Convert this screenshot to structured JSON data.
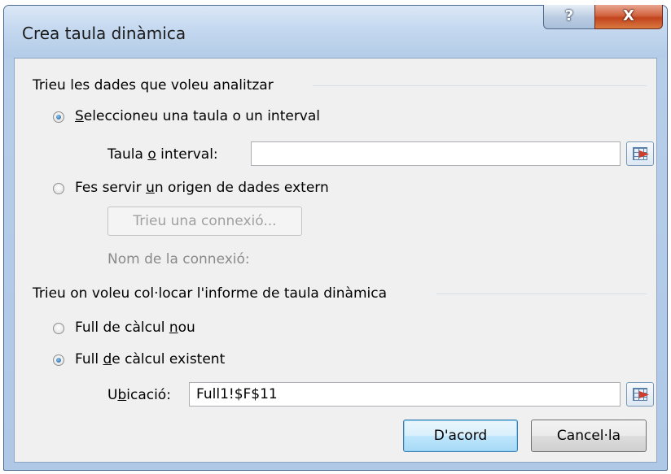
{
  "window": {
    "title": "Crea taula dinàmica",
    "help_label": "?",
    "close_label": "X"
  },
  "section_source": {
    "heading": "Trieu les dades que voleu analitzar",
    "option_table": {
      "label_pre": "",
      "label_u": "S",
      "label_post": "eleccioneu una taula o un interval",
      "checked": true
    },
    "range_field": {
      "label_pre": "Taula ",
      "label_u": "o",
      "label_post": " interval:",
      "value": ""
    },
    "option_external": {
      "label_pre": "Fes servir ",
      "label_u": "u",
      "label_post": "n origen de dades extern",
      "checked": false
    },
    "choose_connection_label": "Trieu una connexió...",
    "connection_name_label": "Nom de la connexió:"
  },
  "section_destination": {
    "heading": "Trieu on voleu col·locar l'informe de taula dinàmica",
    "option_new_sheet": {
      "label_pre": "Full de càlcul ",
      "label_u": "n",
      "label_post": "ou",
      "checked": false
    },
    "option_existing_sheet": {
      "label_pre": "Full ",
      "label_u": "d",
      "label_post": "e càlcul existent",
      "checked": true
    },
    "location_field": {
      "label_pre": "U",
      "label_u": "b",
      "label_post": "icació:",
      "value": "Full1!$F$11"
    }
  },
  "buttons": {
    "ok_label": "D'acord",
    "cancel_label": "Cancel·la"
  },
  "icons": {
    "range_selector": "range-selector-icon"
  }
}
